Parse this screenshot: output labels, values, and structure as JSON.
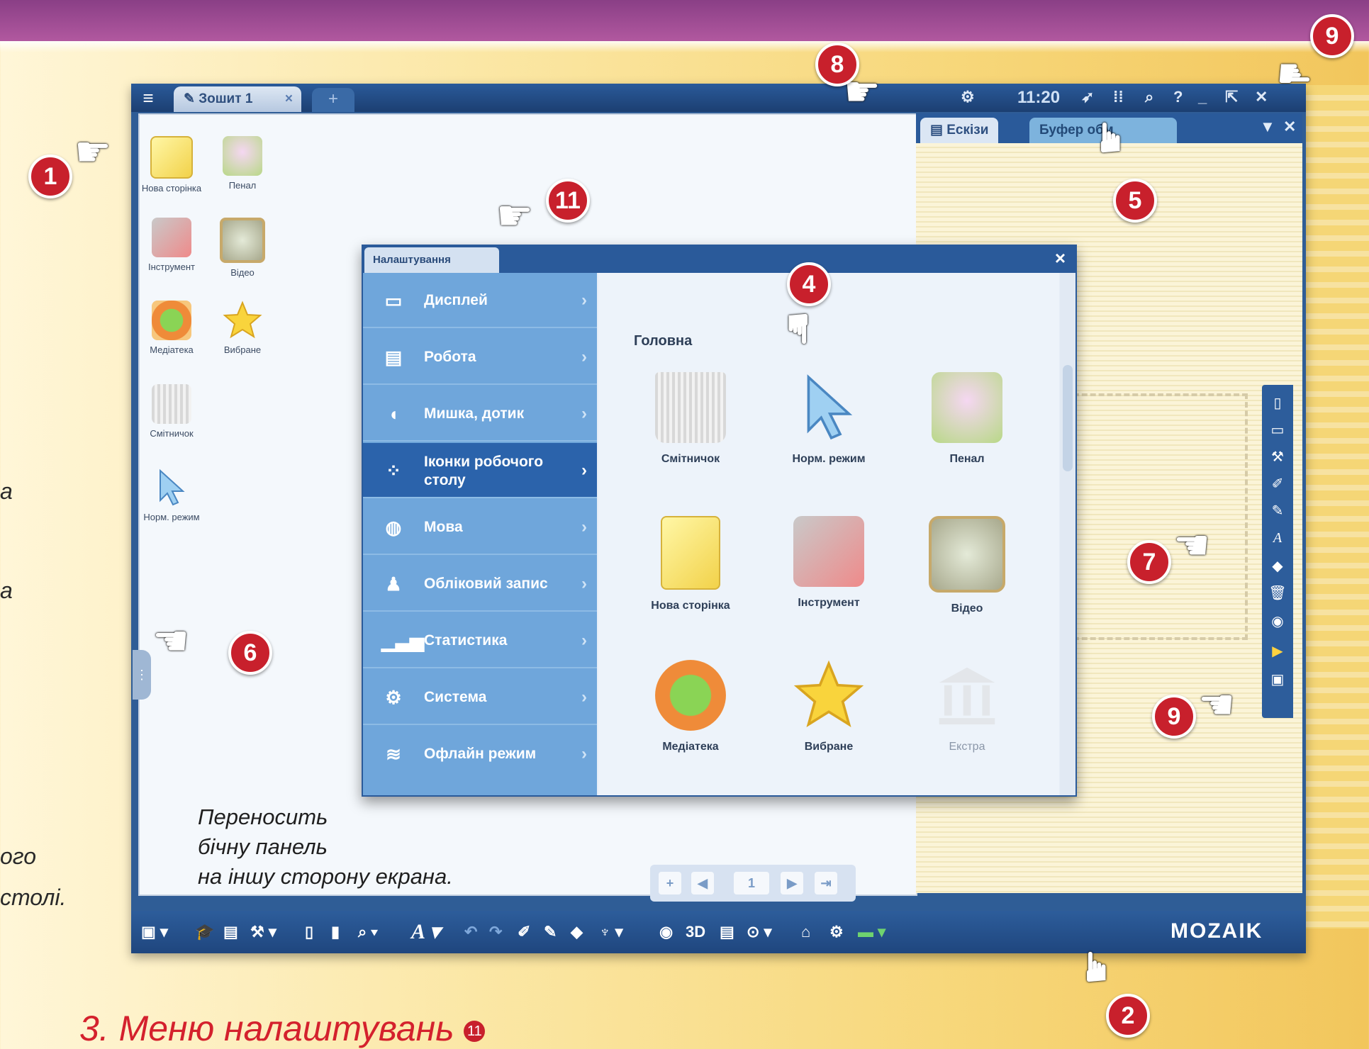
{
  "window": {
    "tab_label": "Зошит 1",
    "tab_close": "×",
    "tab_plus": "+",
    "clock": "11:20"
  },
  "right_panel": {
    "tab1": "Ескізи",
    "tab2": "Буфер обм"
  },
  "desktop_icons": [
    {
      "label": "Нова сторінка"
    },
    {
      "label": "Пенал"
    },
    {
      "label": "Інструмент"
    },
    {
      "label": "Відео"
    },
    {
      "label": "Медіатека"
    },
    {
      "label": "Вибране"
    },
    {
      "label": "Смітничок"
    },
    {
      "label": "Норм. режим"
    }
  ],
  "note_text": [
    "Переносить",
    "бічну панель",
    "на іншу сторону екрана."
  ],
  "pager_page": "1",
  "side_text": [
    "а",
    "а",
    "ого",
    "столі."
  ],
  "section_title": "3. Меню налаштувань",
  "section_title_num": "11",
  "logo": "MOZAIK",
  "bottombar_3d": "3D",
  "settings": {
    "title": "Налаштування",
    "close": "×",
    "menu": [
      {
        "label": "Дисплей"
      },
      {
        "label": "Робота"
      },
      {
        "label": "Мишка, дотик"
      },
      {
        "label": "Іконки робочого столу",
        "line1": "Іконки робочого",
        "line2": "столу",
        "active": true
      },
      {
        "label": "Мова"
      },
      {
        "label": "Обліковий запис"
      },
      {
        "label": "Статистика"
      },
      {
        "label": "Система"
      },
      {
        "label": "Офлайн режим"
      }
    ],
    "section_heading": "Головна",
    "items": [
      {
        "label": "Смітничок"
      },
      {
        "label": "Норм. режим"
      },
      {
        "label": "Пенал"
      },
      {
        "label": "Нова сторінка"
      },
      {
        "label": "Інструмент"
      },
      {
        "label": "Відео"
      },
      {
        "label": "Медіатека"
      },
      {
        "label": "Вибране"
      },
      {
        "label": "Екстра"
      }
    ]
  },
  "callouts": [
    "1",
    "2",
    "4",
    "5",
    "6",
    "7",
    "8",
    "9",
    "9",
    "11"
  ],
  "colors": {
    "accent_red": "#c8202c",
    "window_blue": "#2a5a9a",
    "menu_blue": "#6fa6db",
    "active_menu": "#2b63ab"
  }
}
